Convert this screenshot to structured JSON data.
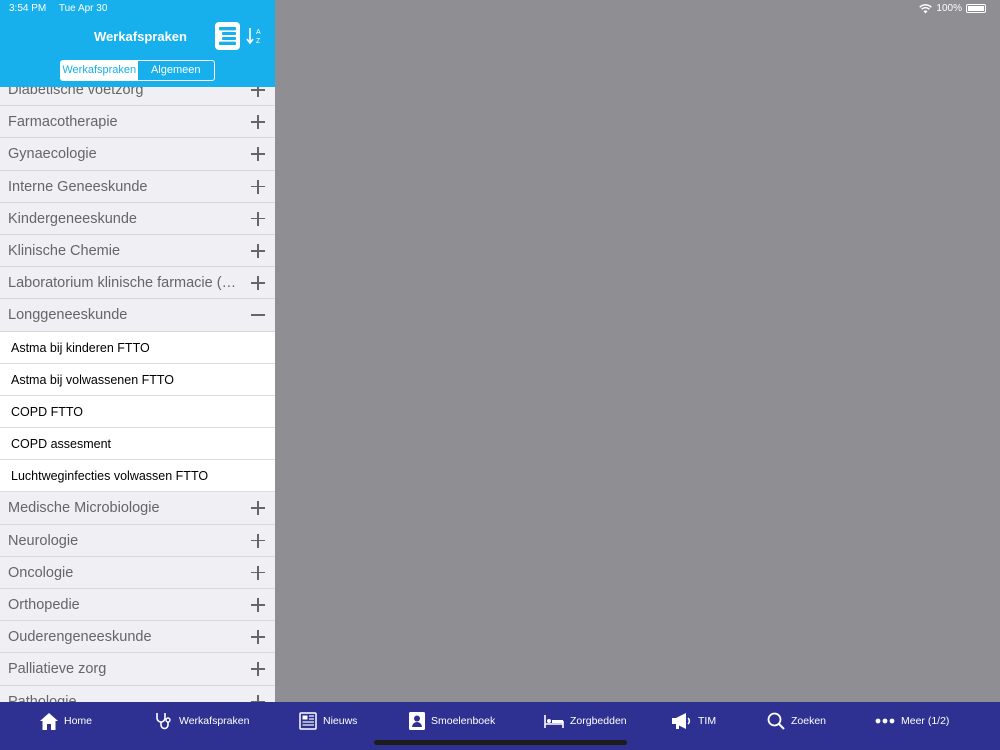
{
  "status": {
    "time": "3:54 PM",
    "date": "Tue Apr 30",
    "battery": "100%"
  },
  "header": {
    "title": "Werkafspraken",
    "list_icon": "list-view-icon",
    "sort_icon": "sort-az-icon"
  },
  "segments": [
    {
      "label": "Werkafspraken",
      "active": true
    },
    {
      "label": "Algemeen",
      "active": false
    }
  ],
  "categories_before": [
    "Diabetische voetzorg",
    "Farmacotherapie",
    "Gynaecologie",
    "Interne Geneeskunde",
    "Kindergeneeskunde",
    "Klinische Chemie",
    "Laboratorium klinische farmacie (ziekenhuisapotheek)"
  ],
  "expanded_category": "Longgeneeskunde",
  "expanded_items": [
    "Astma bij kinderen FTTO",
    "Astma bij volwassenen FTTO",
    "COPD FTTO",
    "COPD assesment",
    "Luchtweginfecties volwassen  FTTO"
  ],
  "categories_after": [
    "Medische Microbiologie",
    "Neurologie",
    "Oncologie",
    "Orthopedie",
    "Ouderengeneeskunde",
    "Palliatieve zorg",
    "Pathologie"
  ],
  "tabs": [
    {
      "label": "Home",
      "icon": "home-icon"
    },
    {
      "label": "Werkafspraken",
      "icon": "stethoscope-icon"
    },
    {
      "label": "Nieuws",
      "icon": "newspaper-icon"
    },
    {
      "label": "Smoelenboek",
      "icon": "contact-book-icon"
    },
    {
      "label": "Zorgbedden",
      "icon": "bed-icon"
    },
    {
      "label": "TIM",
      "icon": "megaphone-icon"
    },
    {
      "label": "Zoeken",
      "icon": "search-icon"
    },
    {
      "label": "Meer (1/2)",
      "icon": "more-icon"
    }
  ],
  "colors": {
    "header": "#17b0ec",
    "tabbar": "#2e3192",
    "detail_bg": "#8e8e93"
  }
}
